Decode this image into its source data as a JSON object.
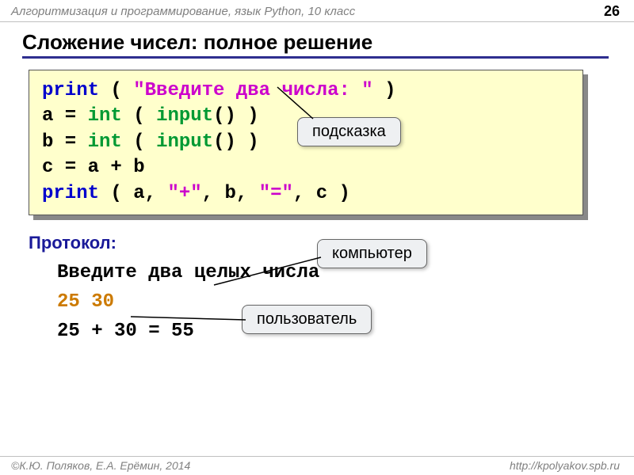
{
  "header": {
    "course": "Алгоритмизация и программирование, язык Python, 10 класс",
    "page": "26"
  },
  "title": "Сложение чисел: полное решение",
  "code": {
    "l1": {
      "print": "print",
      "open": " ( ",
      "str": "\"Введите два числа: \"",
      "close": " )"
    },
    "l2": {
      "var": "a",
      "eq": " = ",
      "int": "int",
      "open": " ( ",
      "input": "input",
      "call": "()",
      "close": " )"
    },
    "l3": {
      "var": "b",
      "eq": " = ",
      "int": "int",
      "open": " ( ",
      "input": "input",
      "call": "()",
      "close": " )"
    },
    "l4": {
      "text": "c = a + b"
    },
    "l5": {
      "print": "print",
      "open": " ( ",
      "a": "a",
      "c1": ", ",
      "s1": "\"+\"",
      "c2": ", ",
      "b": "b",
      "c3": ", ",
      "s2": "\"=\"",
      "c4": ", ",
      "c": "c",
      "close": " )"
    }
  },
  "callouts": {
    "hint": "подсказка",
    "computer": "компьютер",
    "user": "пользователь"
  },
  "protocol": {
    "label": "Протокол:",
    "line1": "Введите два целых числа",
    "line2": "25 30",
    "line3": "25 + 30 = 55"
  },
  "footer": {
    "authors": "К.Ю. Поляков, Е.А. Ерёмин, 2014",
    "url": "http://kpolyakov.spb.ru"
  }
}
